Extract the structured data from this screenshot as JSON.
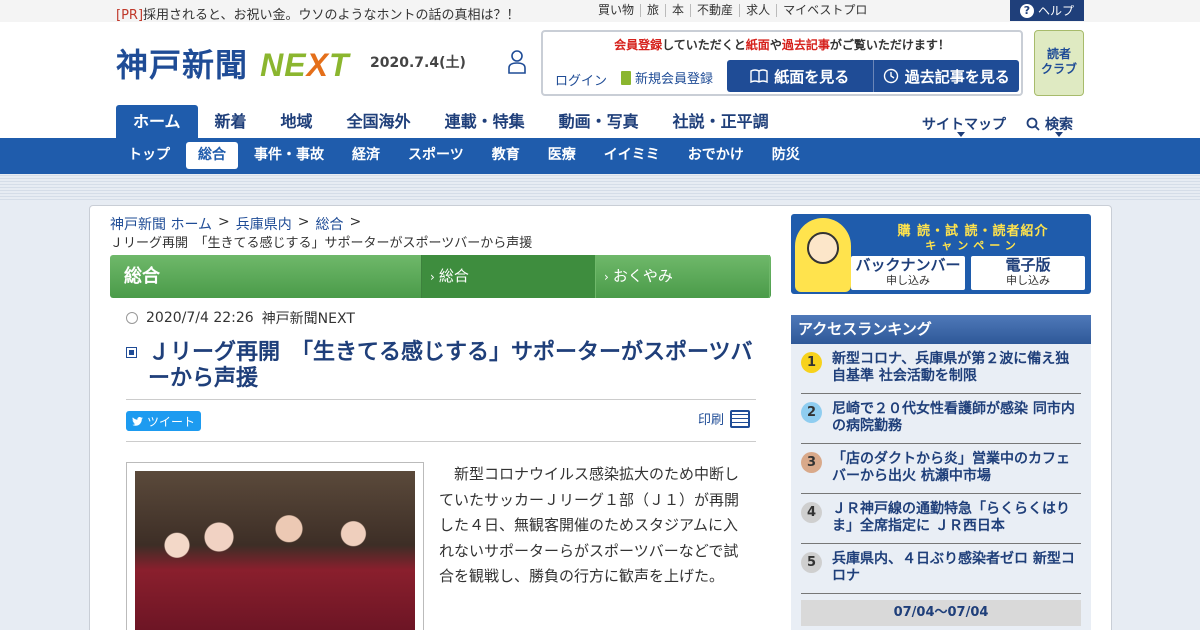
{
  "topbar": {
    "pr_tag": "[PR]",
    "pr_text": "採用されると、お祝い金。ウソのようなホントの話の真相は？！",
    "links": [
      "買い物",
      "旅",
      "本",
      "不動産",
      "求人",
      "マイベストプロ"
    ],
    "help": "ヘルプ"
  },
  "header": {
    "logo_main": "神戸新聞",
    "logo_next": "NE",
    "logo_x": "X",
    "logo_t": "T",
    "date": "2020.7.4(土)",
    "member_msg_1": "会員登録",
    "member_msg_2": "していただくと",
    "member_msg_3": "紙面",
    "member_msg_4": "や",
    "member_msg_5": "過去記事",
    "member_msg_6": "がご覧いただけます！",
    "login": "ログイン",
    "register": "新規会員登録",
    "btn_paper": "紙面を見る",
    "btn_past": "過去記事を見る",
    "reader_club_1": "読者",
    "reader_club_2": "クラブ"
  },
  "main_nav": [
    "ホーム",
    "新着",
    "地域",
    "全国海外",
    "連載・特集",
    "動画・写真",
    "社説・正平調"
  ],
  "sitemap": "サイトマップ",
  "search": "検索",
  "sub_nav": [
    "トップ",
    "総合",
    "事件・事故",
    "経済",
    "スポーツ",
    "教育",
    "医療",
    "イイミミ",
    "おでかけ",
    "防災"
  ],
  "breadcrumb": [
    "神戸新聞 ホーム",
    "兵庫県内",
    "総合"
  ],
  "breadcrumb_sep": ">",
  "breadcrumb_current": "Ｊリーグ再開　「生きてる感じする」サポーターがスポーツバーから声援",
  "section": {
    "title": "総合",
    "tabs": [
      "総合",
      "おくやみ"
    ]
  },
  "article": {
    "date": "2020/7/4 22:26",
    "source": "神戸新聞NEXT",
    "title": "Ｊリーグ再開　「生きてる感じする」サポーターがスポーツバーから声援",
    "tweet": "ツイート",
    "print": "印刷",
    "body": "新型コロナウイルス感染拡大のため中断していたサッカーＪリーグ１部（Ｊ１）が再開した４日、無観客開催のためスタジアムに入れないサポーターらがスポーツバーなどで試合を観戦し、勝負の行方に歓声を上げた。"
  },
  "banner": {
    "top": "購 読・試 読・読者紹介",
    "sub": "キャンペーン",
    "box1_main": "バックナンバー",
    "box1_small": "申し込み",
    "box2_main": "電子版",
    "box2_small": "申し込み"
  },
  "ranking": {
    "heading": "アクセスランキング",
    "items": [
      {
        "num": "1",
        "text": "新型コロナ、兵庫県が第２波に備え独自基準 社会活動を制限",
        "color": "#f7d21c"
      },
      {
        "num": "2",
        "text": "尼崎で２０代女性看護師が感染 同市内の病院勤務",
        "color": "#8fcdf0"
      },
      {
        "num": "3",
        "text": "「店のダクトから炎」営業中のカフェバーから出火 杭瀬中市場",
        "color": "#d9a98a"
      },
      {
        "num": "4",
        "text": "ＪＲ神戸線の通勤特急「らくらくはりま」全席指定に ＪＲ西日本",
        "color": "#cfcfcf"
      },
      {
        "num": "5",
        "text": "兵庫県内、４日ぶり感染者ゼロ 新型コロナ",
        "color": "#cfcfcf"
      }
    ],
    "range": "07/04～07/04"
  }
}
